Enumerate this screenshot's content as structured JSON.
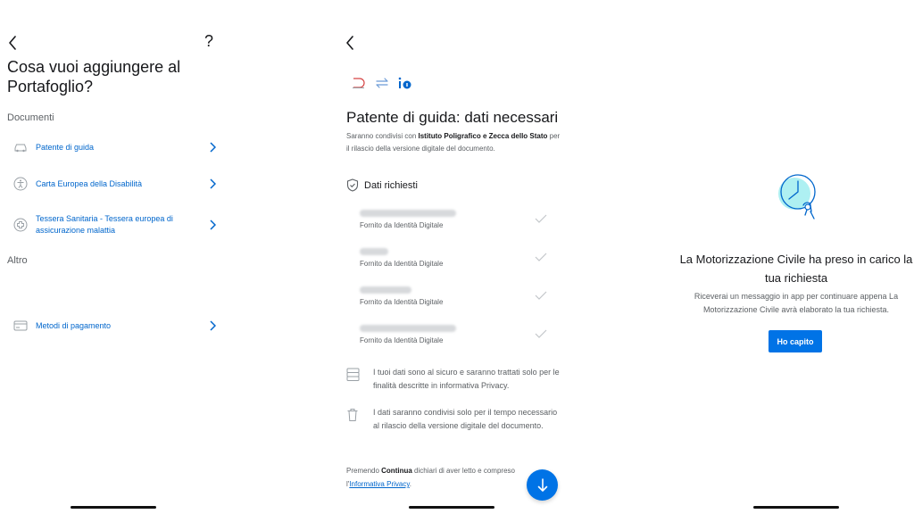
{
  "screen1": {
    "help_symbol": "?",
    "title": "Cosa vuoi aggiungere al Portafoglio?",
    "section_documents": "Documenti",
    "items": [
      {
        "label": "Patente di guida",
        "icon": "car-icon"
      },
      {
        "label": "Carta Europea della Disabilità",
        "icon": "accessibility-icon"
      },
      {
        "label": "Tessera Sanitaria - Tessera europea di assicurazione malattia",
        "icon": "health-card-icon"
      }
    ],
    "section_other": "Altro",
    "other_items": [
      {
        "label": "Metodi di pagamento",
        "icon": "credit-card-icon"
      }
    ]
  },
  "screen2": {
    "title": "Patente di guida: dati necessari",
    "subtitle_pre": "Saranno condivisi con ",
    "subtitle_org": "Istituto Poligrafico e Zecca dello Stato",
    "subtitle_post": " per il rilascio della versione digitale del documento.",
    "required_header": "Dati richiesti",
    "fields": [
      {
        "provider": "Fornito da Identità Digitale"
      },
      {
        "provider": "Fornito da Identità Digitale"
      },
      {
        "provider": "Fornito da Identità Digitale"
      },
      {
        "provider": "Fornito da Identità Digitale"
      }
    ],
    "info_security": "I tuoi dati sono al sicuro e saranno trattati solo per le finalità descritte in informativa Privacy.",
    "info_retention": "I dati saranno condivisi solo per il tempo necessario al rilascio della versione digitale del documento.",
    "footer_pre": "Premendo ",
    "footer_bold": "Continua",
    "footer_mid": " dichiari di aver letto e compreso l'",
    "footer_link": "Informativa Privacy",
    "footer_end": "."
  },
  "screen3": {
    "title": "La Motorizzazione Civile ha preso in carico la tua richiesta",
    "body": "Riceverai un messaggio in app per continuare appena La Motorizzazione Civile avrà elaborato la tua richiesta.",
    "button_label": "Ho capito"
  },
  "colors": {
    "accent": "#0073e6",
    "link": "#0066cc",
    "text": "#17181b",
    "muted": "#5c6064"
  }
}
